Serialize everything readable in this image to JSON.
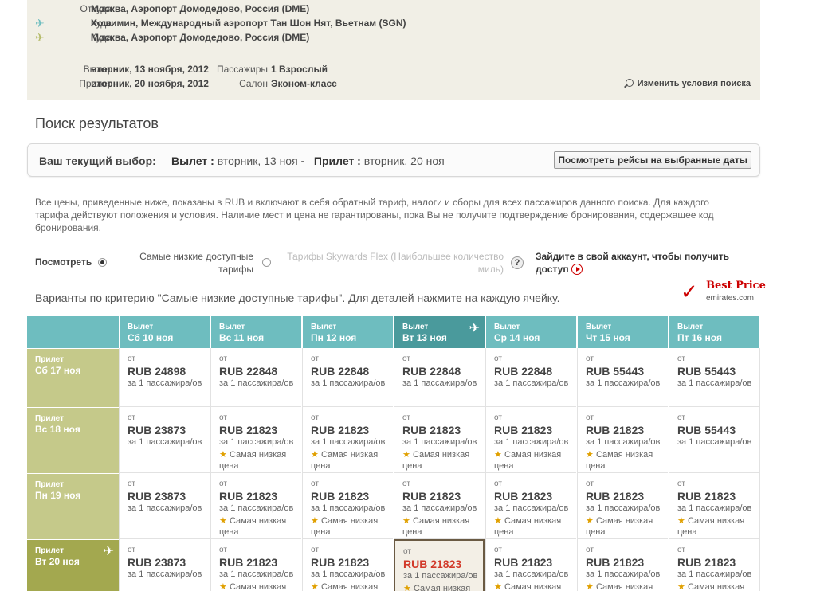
{
  "summary": {
    "route": [
      {
        "label": "Откуда",
        "value": "Москва, Аэропорт Домодедово, Россия (DME)",
        "icon": ""
      },
      {
        "label": "Куда",
        "value": "Хошимин, Международный аэропорт Тан Шон Нят, Вьетнам (SGN)",
        "icon": "plane-outbound-icon"
      },
      {
        "label": "Куда",
        "value": "Москва, Аэропорт Домодедово, Россия (DME)",
        "icon": "plane-return-icon"
      }
    ],
    "departure_label": "Вылет",
    "departure_value": "вторник, 13 ноября, 2012",
    "return_label": "Прилет",
    "return_value": "вторник, 20 ноября, 2012",
    "passengers_label": "Пассажиры",
    "passengers_value": "1 Взрослый",
    "cabin_label": "Салон",
    "cabin_value": "Эконом-класс",
    "modify_label": "Изменить условия поиска"
  },
  "page_title": "Поиск результатов",
  "selection": {
    "current_label": "Ваш текущий выбор:",
    "dep_label": "Вылет :",
    "dep_value": "вторник, 13 ноя",
    "dash": "-",
    "ret_label": "Прилет :",
    "ret_value": "вторник, 20 ноя",
    "view_button": "Посмотреть рейсы на выбранные даты"
  },
  "disclaimer": "Все цены, приведенные ниже, показаны в RUB и включают в себя обратный тариф, налоги и сборы для всех пассажиров данного поиска. Для каждого тарифа действуют положения и условия. Наличие мест и цена не гарантированы, пока Вы не получите подтверждение бронирования, содержащее код бронирования.",
  "fare_options": {
    "view_label": "Посмотреть",
    "lowest_label": "Самые низкие доступные тарифы",
    "flex_label": "Тарифы Skywards Flex (Наибольшее количество миль)",
    "help": "?",
    "login_text": "Зайдите в свой аккаунт, чтобы получить доступ"
  },
  "variants_text": "Варианты по критерию \"Самые низкие доступные тарифы\". Для деталей нажмите на каждую ячейку.",
  "best_price": {
    "title": "Best Price",
    "site": "emirates.com"
  },
  "grid": {
    "col_kicker": "Вылет",
    "row_kicker": "Прилет",
    "columns": [
      "Сб 10 ноя",
      "Вс 11 ноя",
      "Пн 12 ноя",
      "Вт 13 ноя",
      "Ср 14 ноя",
      "Чт 15 ноя",
      "Пт 16 ноя"
    ],
    "selected_col": 3,
    "rows": [
      "Сб 17 ноя",
      "Вс 18 ноя",
      "Пн 19 ноя",
      "Вт 20 ноя"
    ],
    "selected_row": 3,
    "from_label": "от",
    "per_pax": "за 1 пассажира/ов",
    "lowest_tag": "Самая низкая цена",
    "prices": [
      [
        "RUB 24898",
        "RUB 22848",
        "RUB 22848",
        "RUB 22848",
        "RUB 22848",
        "RUB 55443",
        "RUB 55443"
      ],
      [
        "RUB 23873",
        "RUB 21823",
        "RUB 21823",
        "RUB 21823",
        "RUB 21823",
        "RUB 21823",
        "RUB 55443"
      ],
      [
        "RUB 23873",
        "RUB 21823",
        "RUB 21823",
        "RUB 21823",
        "RUB 21823",
        "RUB 21823",
        "RUB 21823"
      ],
      [
        "RUB 23873",
        "RUB 21823",
        "RUB 21823",
        "RUB 21823",
        "RUB 21823",
        "RUB 21823",
        "RUB 21823"
      ]
    ],
    "lowest": [
      [
        false,
        false,
        false,
        false,
        false,
        false,
        false
      ],
      [
        false,
        true,
        true,
        true,
        true,
        true,
        false
      ],
      [
        false,
        true,
        true,
        true,
        true,
        true,
        true
      ],
      [
        false,
        true,
        true,
        true,
        true,
        true,
        true
      ]
    ]
  },
  "colors": {
    "header_teal": "#6ebdbf",
    "header_teal_selected": "#4a9a9c",
    "row_olive": "#c5c98a",
    "row_olive_selected": "#a3a84f",
    "selected_price": "#d23a2a",
    "star": "#e0a000"
  }
}
